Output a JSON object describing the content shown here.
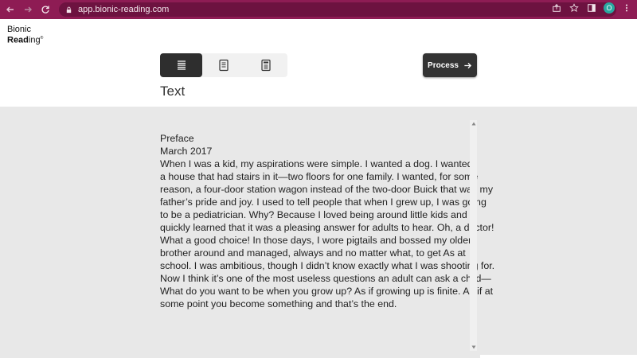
{
  "browser": {
    "url": "app.bionic-reading.com",
    "profile_initial": "O"
  },
  "logo": {
    "line1": "Bionic",
    "line2_bold": "Read",
    "line2_rest": "ing",
    "mark": "®"
  },
  "toolbar": {
    "view_icons": [
      "text-view-icon",
      "document-view-icon",
      "file-view-icon"
    ],
    "process_label": "Process"
  },
  "section_title": "Text",
  "text_lines": [
    "Preface",
    "March 2017",
    "When I was a kid, my aspirations were simple. I wanted a dog. I wanted",
    "a house that had stairs in it—two floors for one family. I wanted, for some",
    "reason, a four-door station wagon instead of the two-door Buick that was my",
    "father’s pride and joy. I used to tell people that when I grew up, I was going",
    "to be a pediatrician. Why? Because I loved being around little kids and I",
    "quickly learned that it was a pleasing answer for adults to hear. Oh, a doctor!",
    "What a good choice! In those days, I wore pigtails and bossed my older",
    "brother around and managed, always and no matter what, to get As at",
    "school. I was ambitious, though I didn’t know exactly what I was shooting for.",
    "Now I think it’s one of the most useless questions an adult can ask a child—",
    "What do you want to be when you grow up? As if growing up is finite. As if at",
    "some point you become something and that’s the end."
  ],
  "colors": {
    "browser_bar": "#8e1c54",
    "accent_dark": "#2e2e2e",
    "text_area_bg": "#e8e8e8"
  }
}
